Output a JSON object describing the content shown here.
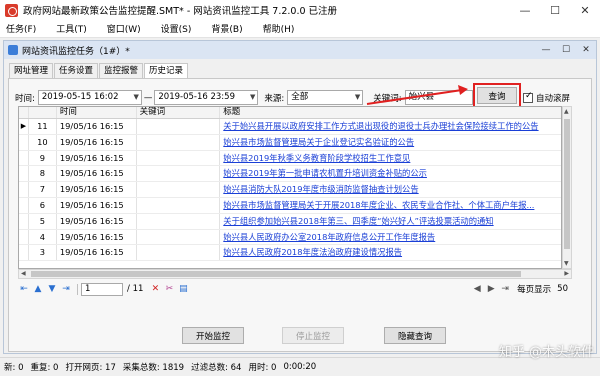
{
  "window": {
    "title": "政府网站最新政策公告监控提醒.SMT* - 网站资讯监控工具 7.2.0.0 已注册",
    "min_label": "—",
    "max_label": "☐",
    "close_label": "✕"
  },
  "menu": [
    "任务(F)",
    "工具(T)",
    "窗口(W)",
    "设置(S)",
    "背景(B)",
    "帮助(H)"
  ],
  "child_window": {
    "title": "网站资讯监控任务（1#）*",
    "min_label": "—",
    "max_label": "☐",
    "close_label": "✕"
  },
  "tabs": [
    "网址管理",
    "任务设置",
    "监控报警",
    "历史记录"
  ],
  "active_tab": 3,
  "filters": {
    "time_label": "时间:",
    "start": "2019-05-15 16:02",
    "separator": "—",
    "end": "2019-05-16 23:59",
    "source_label": "来源:",
    "source_value": "全部",
    "keyword_label": "关键词:",
    "keyword_value": "始兴县",
    "query_button": "查询",
    "autoscroll_label": "自动滚屏",
    "autoscroll_checked": true
  },
  "table": {
    "columns": [
      "",
      "时间",
      "关键词",
      "标题"
    ],
    "rows": [
      {
        "marker": "▶",
        "id": "11",
        "time": "19/05/16 16:15",
        "keyword": "",
        "title": "关于始兴县开展以政府安排工作方式退出现役的退役士兵办理社会保险接续工作的公告"
      },
      {
        "marker": "",
        "id": "10",
        "time": "19/05/16 16:15",
        "keyword": "",
        "title": "始兴县市场监督管理局关于企业登记实名验证的公告"
      },
      {
        "marker": "",
        "id": "9",
        "time": "19/05/16 16:15",
        "keyword": "",
        "title": "始兴县2019年秋季义务教育阶段学校招生工作意见"
      },
      {
        "marker": "",
        "id": "8",
        "time": "19/05/16 16:15",
        "keyword": "",
        "title": "始兴县2019年第一批申请农机置升培训资金补贴的公示"
      },
      {
        "marker": "",
        "id": "7",
        "time": "19/05/16 16:15",
        "keyword": "",
        "title": "始兴县消防大队2019年度市级消防监督抽查计划公告"
      },
      {
        "marker": "",
        "id": "6",
        "time": "19/05/16 16:15",
        "keyword": "",
        "title": "始兴县市场监督管理局关于开展2018年度企业、农民专业合作社、个体工商户年报..."
      },
      {
        "marker": "",
        "id": "5",
        "time": "19/05/16 16:15",
        "keyword": "",
        "title": "关于组织参加始兴县2018年第三、四季度“始兴好人”评选投票活动的通知"
      },
      {
        "marker": "",
        "id": "4",
        "time": "19/05/16 16:15",
        "keyword": "",
        "title": "始兴县人民政府办公室2018年政府信息公开工作年度报告"
      },
      {
        "marker": "",
        "id": "3",
        "time": "19/05/16 16:15",
        "keyword": "",
        "title": "始兴县人民政府2018年度法治政府建设情况报告"
      }
    ]
  },
  "pager": {
    "page": "1",
    "total": "/ 11",
    "per_page_label": "每页显示",
    "per_page_value": "50"
  },
  "buttons": {
    "start": "开始监控",
    "stop": "停止监控",
    "hide_query": "隐藏查询"
  },
  "status": [
    "新: 0",
    "重复: 0",
    "打开网页: 17",
    "采集总数: 1819",
    "过滤总数: 64",
    "用时: 0",
    "0:00:20"
  ],
  "watermark": "知乎 @木头软件",
  "colors": {
    "link": "#1a3fd6",
    "highlight": "#e02020",
    "child_title": "#dbe5f3"
  }
}
